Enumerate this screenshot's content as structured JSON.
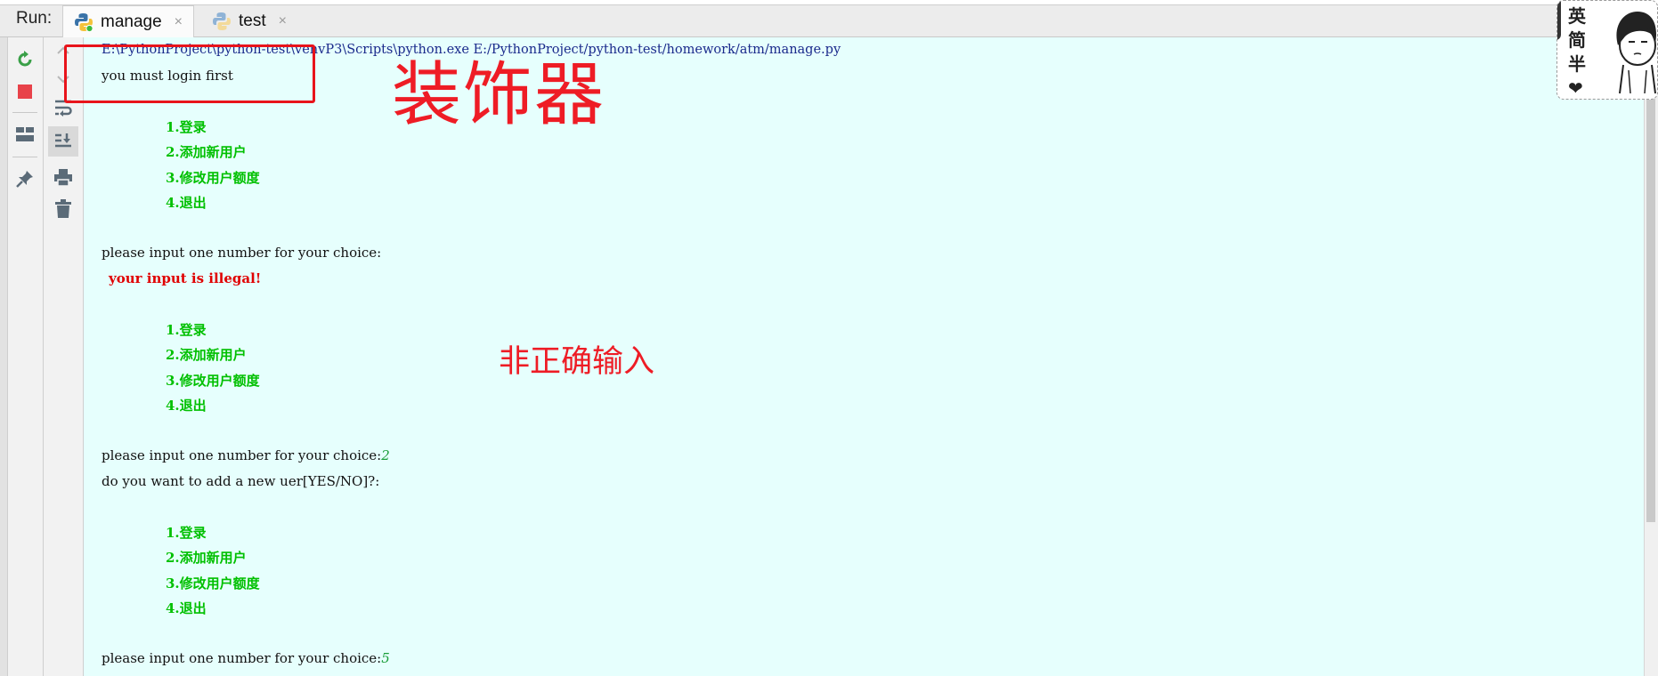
{
  "run_panel": {
    "label": "Run:",
    "tabs": [
      {
        "label": "manage",
        "close": "×"
      },
      {
        "label": "test",
        "close": "×"
      }
    ]
  },
  "console": {
    "command": "E:\\PythonProject\\python-test\\venvP3\\Scripts\\python.exe E:/PythonProject/python-test/homework/atm/manage.py",
    "login_msg": "you must login first",
    "menu": [
      "1.登录",
      "2.添加新用户",
      "3.修改用户额度",
      "4.退出"
    ],
    "prompt": "please input one number for your choice:",
    "error_msg": "your input is illegal!",
    "input_1": "2",
    "add_user_prompt": "do you want to add a new uer[YES/NO]?:",
    "input_2": "5"
  },
  "annotations": {
    "decorator": "装饰器",
    "invalid_input": "非正确输入"
  },
  "watermark": {
    "text": [
      "英",
      "简",
      "半",
      "❤"
    ]
  },
  "toolbar_icons": [
    "rerun-icon",
    "stop-icon",
    "layout-icon",
    "pin-icon",
    "scroll-up-icon",
    "scroll-down-icon",
    "soft-wrap-icon",
    "scroll-to-end-icon",
    "print-icon",
    "trash-icon"
  ],
  "colors": {
    "console_bg": "#e6fffd",
    "menu_text": "#00c000",
    "error_text": "#e00000",
    "annotation_red": "#ee1c25"
  }
}
